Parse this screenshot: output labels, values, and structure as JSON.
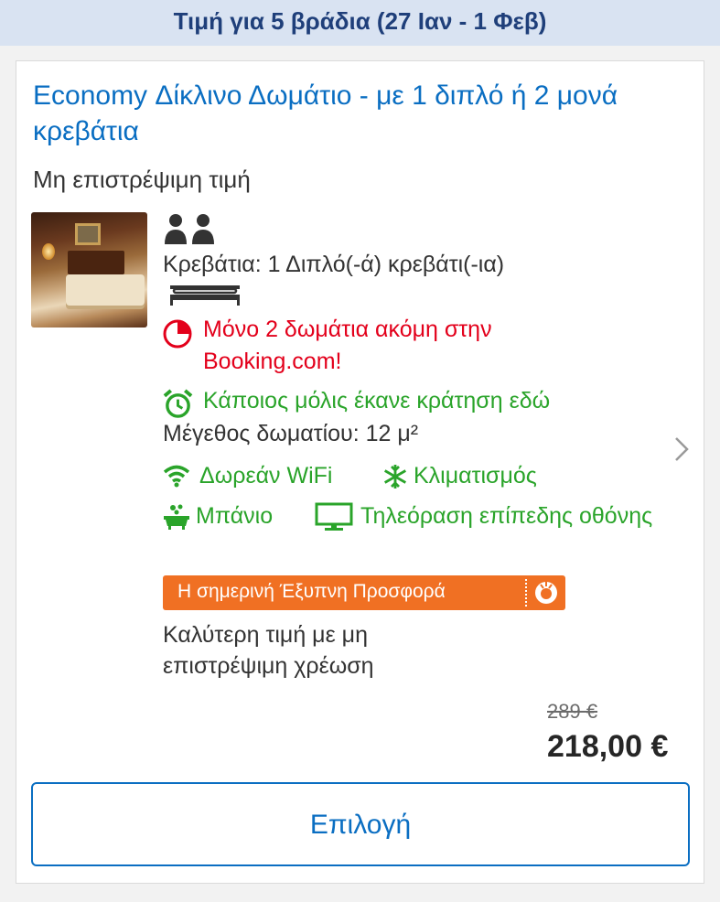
{
  "header": {
    "price_for_nights": "Τιμή για 5 βράδια (27 Ιαν - 1 Φεβ)"
  },
  "room": {
    "title": "Economy Δίκλινο Δωμάτιο - με 1 διπλό ή 2 μονά κρεβάτια",
    "policy": "Μη επιστρέψιμη τιμή",
    "beds": "Κρεβάτια: 1 Διπλό(-ά) κρεβάτι(-ια)",
    "scarcity": "Μόνο 2 δωμάτια ακόμη στην Booking.com!",
    "recent_booking": "Κάποιος μόλις έκανε κράτηση εδώ",
    "size": "Μέγεθος δωματίου: 12 μ²",
    "facilities": {
      "wifi": "Δωρεάν WiFi",
      "ac": "Κλιματισμός",
      "bath": "Μπάνιο",
      "tv": "Τηλεόραση επίπεδης οθόνης"
    },
    "promo": "Η σημερινή Έξυπνη Προσφορά",
    "best_price": "Καλύτερη τιμή με μη επιστρέψιμη χρέωση",
    "old_price": "289 €",
    "new_price": "218,00 €",
    "select_label": "Επιλογή"
  },
  "colors": {
    "link": "#0a6ec2",
    "green": "#2aa42a",
    "red": "#e3001b",
    "promo": "#f07023"
  },
  "icons": [
    "people-icon",
    "bed-icon",
    "clock-icon",
    "alarm-clock-icon",
    "wifi-icon",
    "snowflake-icon",
    "bath-icon",
    "tv-icon",
    "chevron-right-icon"
  ]
}
